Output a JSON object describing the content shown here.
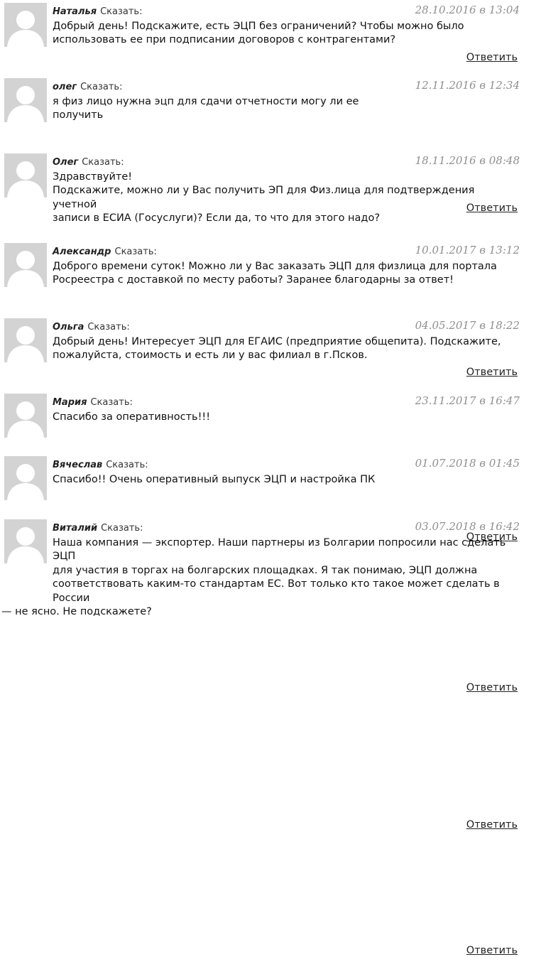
{
  "says_label": "Сказать:",
  "reply_label": "Ответить",
  "comments": [
    {
      "author": "Наталья",
      "date": "28.10.2016 в 13:04",
      "lines": [
        "Добрый день! Подскажите, есть ЭЦП без ограничений? Чтобы можно было",
        "использовать ее при подписании договоров с контрагентами?"
      ]
    },
    {
      "author": "олег",
      "date": "12.11.2016 в 12:34",
      "lines": [
        "я физ лицо нужна эцп для сдачи отчетности могу ли ее",
        "получить"
      ]
    },
    {
      "author": "Олег",
      "date": "18.11.2016 в 08:48",
      "lines": [
        "Здравствуйте!",
        "Подскажите, можно ли у Вас получить ЭП для Физ.лица для подтверждения учетной",
        "записи в ЕСИА (Госуслуги)? Если да, то что для этого надо?"
      ]
    },
    {
      "author": "Александр",
      "date": "10.01.2017 в 13:12",
      "lines": [
        "Доброго времени суток! Можно ли у Вас заказать ЭЦП для физлица для портала",
        "Росреестра с доставкой по месту работы? Заранее благодарны за ответ!"
      ]
    },
    {
      "author": "Ольга",
      "date": "04.05.2017 в 18:22",
      "lines": [
        "Добрый день! Интересует ЭЦП для ЕГАИС (предприятие общепита). Подскажите,",
        "пожалуйста, стоимость и есть ли у вас филиал в г.Псков."
      ]
    },
    {
      "author": "Мария",
      "date": "23.11.2017 в 16:47",
      "lines": [
        "Спасибо за оперативность!!!"
      ]
    },
    {
      "author": "Вячеслав",
      "date": "01.07.2018 в 01:45",
      "lines": [
        "Спасибо!! Очень оперативный выпуск ЭЦП и настройка ПК"
      ]
    },
    {
      "author": "Виталий",
      "date": "03.07.2018 в 16:42",
      "lines": [
        "Наша компания — экспортер. Наши партнеры из Болгарии попросили нас сделать ЭЦП",
        "для участия в торгах на болгарских площадках. Я так понимаю, ЭЦП должна",
        "соответствовать каким-то стандартам ЕС. Вот только кто такое может сделать в России",
        "— не ясно. Не подскажете?"
      ]
    }
  ]
}
